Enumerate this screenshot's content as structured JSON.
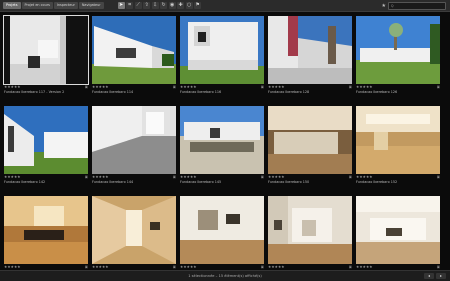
{
  "toolbar": {
    "tabs": [
      "Projets",
      "Projet en cours",
      "Inspecteur",
      "Navigateur"
    ],
    "tool_icons": [
      "select-icon",
      "crop-icon",
      "straighten-icon",
      "lift-icon",
      "stamp-icon",
      "rotate-icon",
      "redeye-icon",
      "patch-icon",
      "loupe-icon",
      "flag-icon"
    ],
    "search_placeholder": "Q"
  },
  "photos": [
    {
      "caption": "Fundacao Iberebaro 117 - Version 2",
      "stars": "★★★★★",
      "selected": true
    },
    {
      "caption": "Fundacao Iberebaro 114",
      "stars": "★★★★★",
      "selected": false
    },
    {
      "caption": "Fundacao Iberebaro 116",
      "stars": "★★★★★",
      "selected": false
    },
    {
      "caption": "Fundacao Iberebaro 128",
      "stars": "★★★★★",
      "selected": false
    },
    {
      "caption": "Fundacao Iberebaro 126",
      "stars": "★★★★★",
      "selected": false
    },
    {
      "caption": "Fundacao Iberebaro 142",
      "stars": "★★★★★",
      "selected": false
    },
    {
      "caption": "Fundacao Iberebaro 144",
      "stars": "★★★★★",
      "selected": false
    },
    {
      "caption": "Fundacao Iberebaro 145",
      "stars": "★★★★★",
      "selected": false
    },
    {
      "caption": "Fundacao Iberebaro 150",
      "stars": "★★★★★",
      "selected": false
    },
    {
      "caption": "Fundacao Iberebaro 152",
      "stars": "★★★★★",
      "selected": false
    },
    {
      "caption": "Fundacao Iberebaro 158",
      "stars": "★★★★★",
      "selected": false
    },
    {
      "caption": "Fundacao Iberebaro 160",
      "stars": "★★★★★",
      "selected": false
    },
    {
      "caption": "Fundacao Iberebaro 171",
      "stars": "★★★★★",
      "selected": false
    },
    {
      "caption": "Fundacao Iberebaro 173",
      "stars": "★★★★★",
      "selected": false
    },
    {
      "caption": "Fundacao Iberebaro 174",
      "stars": "★★★★★",
      "selected": false
    }
  ],
  "status": {
    "text": "1 sélectionnée – 15 élément(s) affiché(s)"
  },
  "nav": {
    "prev": "◂",
    "next": "▸"
  },
  "colors": {
    "background": "#0b0b0b",
    "toolbar": "#2b2b2b",
    "selection": "#dcdcdc"
  }
}
